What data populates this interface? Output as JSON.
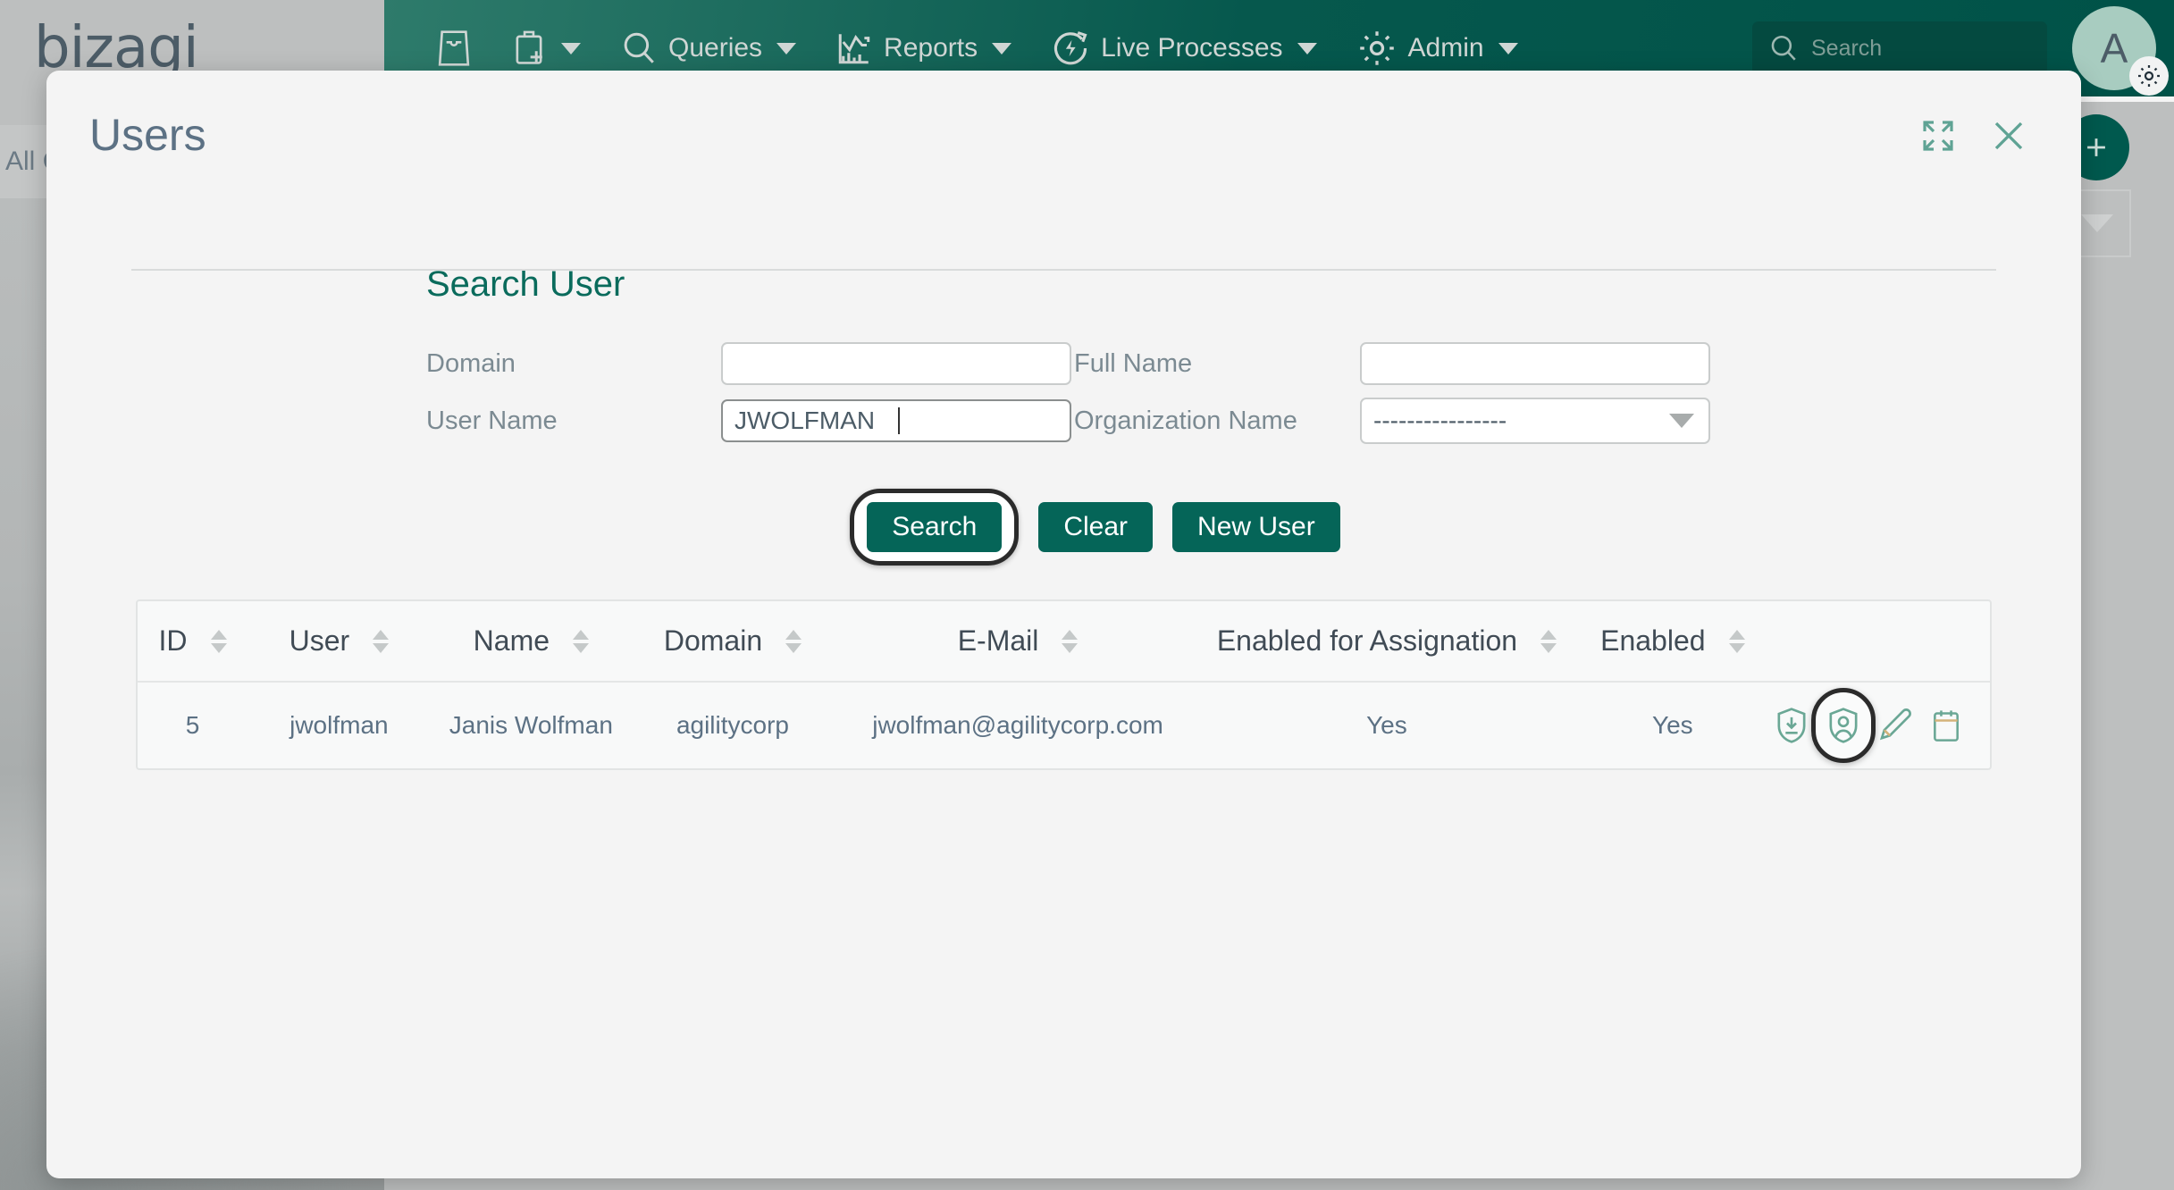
{
  "brand": {
    "logo_text": "bizagi"
  },
  "topnav": {
    "items": [
      {
        "label": "",
        "icon": "inbox-icon",
        "has_caret": false
      },
      {
        "label": "",
        "icon": "new-case-icon",
        "has_caret": true
      },
      {
        "label": "Queries",
        "icon": "search-icon",
        "has_caret": true
      },
      {
        "label": "Reports",
        "icon": "reports-chart-icon",
        "has_caret": true
      },
      {
        "label": "Live Processes",
        "icon": "live-processes-icon",
        "has_caret": true
      },
      {
        "label": "Admin",
        "icon": "gear-icon",
        "has_caret": true
      }
    ],
    "search_placeholder": "Search",
    "avatar_initial": "A"
  },
  "background": {
    "all_cases_label": "All C"
  },
  "modal": {
    "title": "Users",
    "expand_icon": "expand-icon",
    "close_icon": "close-icon",
    "section_title": "Search User",
    "form": {
      "domain_label": "Domain",
      "domain_value": "",
      "full_name_label": "Full Name",
      "full_name_value": "",
      "user_name_label": "User Name",
      "user_name_value": "JWOLFMAN",
      "organization_label": "Organization Name",
      "organization_value": "----------------"
    },
    "buttons": {
      "search": "Search",
      "clear": "Clear",
      "new_user": "New User"
    },
    "table": {
      "columns": [
        {
          "label": "ID",
          "sortable": true
        },
        {
          "label": "User",
          "sortable": true
        },
        {
          "label": "Name",
          "sortable": true
        },
        {
          "label": "Domain",
          "sortable": true
        },
        {
          "label": "E-Mail",
          "sortable": true
        },
        {
          "label": "Enabled for Assignation",
          "sortable": true
        },
        {
          "label": "Enabled",
          "sortable": true
        },
        {
          "label": "",
          "sortable": false
        }
      ],
      "rows": [
        {
          "id": "5",
          "user": "jwolfman",
          "name": "Janis Wolfman",
          "domain": "agilitycorp",
          "email": "jwolfman@agilitycorp.com",
          "enabled_for_assignation": "Yes",
          "enabled": "Yes",
          "actions": [
            {
              "name": "shield-download-icon",
              "highlighted": false
            },
            {
              "name": "shield-user-icon",
              "highlighted": true
            },
            {
              "name": "edit-pencil-icon",
              "highlighted": false
            },
            {
              "name": "clipboard-icon",
              "highlighted": false
            }
          ]
        }
      ]
    }
  },
  "colors": {
    "brand_green": "#056558",
    "nav_green": "#005248",
    "accent_teal": "#5fa394",
    "title_slate": "#5c7184",
    "section_green": "#0a6b5c"
  }
}
